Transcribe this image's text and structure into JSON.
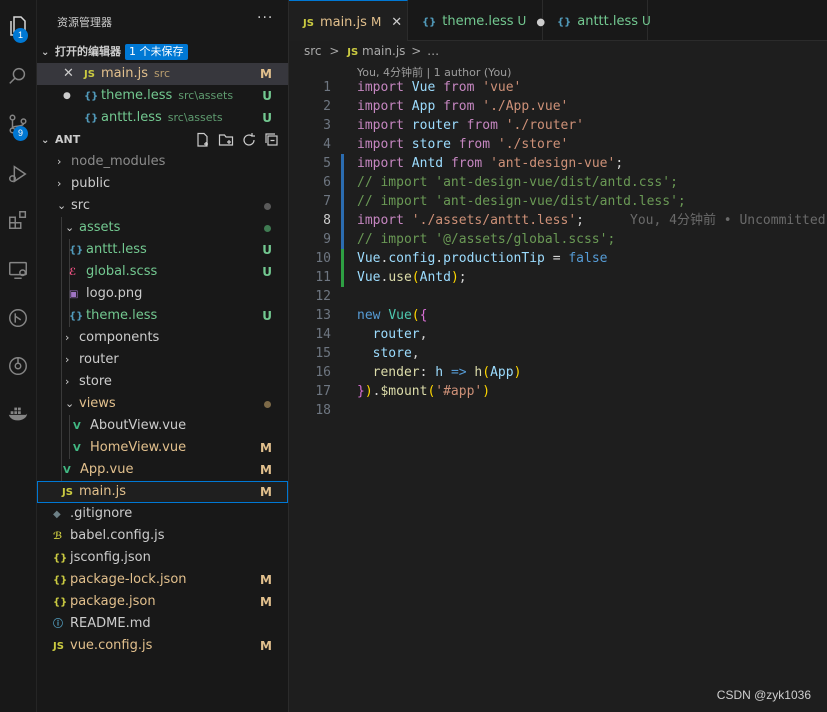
{
  "activity_bar": {
    "explorer_badge": "1",
    "scm_badge": "9"
  },
  "explorer": {
    "title": "资源管理器",
    "more_icon": "···",
    "open_editors": {
      "title": "打开的编辑器",
      "unsaved_badge": "1 个未保存",
      "items": [
        {
          "prefix": "✕",
          "icon": "JS",
          "name": "main.js",
          "path": "src",
          "status": "M"
        },
        {
          "prefix": "●",
          "icon": "{}",
          "name": "theme.less",
          "path": "src\\assets",
          "status": "U"
        },
        {
          "prefix": "",
          "icon": "{}",
          "name": "anttt.less",
          "path": "src\\assets",
          "status": "U"
        }
      ]
    },
    "project": {
      "title": "ANT",
      "tree": [
        {
          "chev": "›",
          "icon": "",
          "name": "node_modules",
          "status": ""
        },
        {
          "chev": "›",
          "icon": "",
          "name": "public",
          "status": ""
        },
        {
          "chev": "⌄",
          "icon": "",
          "name": "src",
          "status": ""
        },
        {
          "chev": "⌄",
          "icon": "",
          "name": "assets",
          "status": ""
        },
        {
          "chev": "",
          "icon": "{}",
          "name": "anttt.less",
          "status": "U"
        },
        {
          "chev": "",
          "icon": "ℰ",
          "name": "global.scss",
          "status": "U"
        },
        {
          "chev": "",
          "icon": "▣",
          "name": "logo.png",
          "status": ""
        },
        {
          "chev": "",
          "icon": "{}",
          "name": "theme.less",
          "status": "U"
        },
        {
          "chev": "›",
          "icon": "",
          "name": "components",
          "status": ""
        },
        {
          "chev": "›",
          "icon": "",
          "name": "router",
          "status": ""
        },
        {
          "chev": "›",
          "icon": "",
          "name": "store",
          "status": ""
        },
        {
          "chev": "⌄",
          "icon": "",
          "name": "views",
          "status": ""
        },
        {
          "chev": "",
          "icon": "V",
          "name": "AboutView.vue",
          "status": ""
        },
        {
          "chev": "",
          "icon": "V",
          "name": "HomeView.vue",
          "status": "M"
        },
        {
          "chev": "",
          "icon": "V",
          "name": "App.vue",
          "status": "M"
        },
        {
          "chev": "",
          "icon": "JS",
          "name": "main.js",
          "status": "M"
        },
        {
          "chev": "",
          "icon": "◆",
          "name": ".gitignore",
          "status": ""
        },
        {
          "chev": "",
          "icon": "ℬ",
          "name": "babel.config.js",
          "status": ""
        },
        {
          "chev": "",
          "icon": "{}",
          "name": "jsconfig.json",
          "status": ""
        },
        {
          "chev": "",
          "icon": "{}",
          "name": "package-lock.json",
          "status": "M"
        },
        {
          "chev": "",
          "icon": "{}",
          "name": "package.json",
          "status": "M"
        },
        {
          "chev": "",
          "icon": "ⓘ",
          "name": "README.md",
          "status": ""
        },
        {
          "chev": "",
          "icon": "JS",
          "name": "vue.config.js",
          "status": "M"
        }
      ]
    }
  },
  "tabs": [
    {
      "icon": "JS",
      "label": "main.js",
      "status": "M",
      "right": "✕"
    },
    {
      "icon": "{}",
      "label": "theme.less",
      "status": "U",
      "right": "●"
    },
    {
      "icon": "{}",
      "label": "anttt.less",
      "status": "U",
      "right": ""
    }
  ],
  "breadcrumb": {
    "folder": "src",
    "sep": ">",
    "icon": "JS",
    "file": "main.js",
    "more": "…"
  },
  "blame": {
    "header": "You, 4分钟前 | 1 author (You)"
  },
  "editor": {
    "lines": [
      {
        "n": "1",
        "code": "<span class='cf'>import</span> <span class='id'>Vue</span> <span class='cf'>from</span> <span class='str'>'vue'</span>",
        "mark": ""
      },
      {
        "n": "2",
        "code": "<span class='cf'>import</span> <span class='id'>App</span> <span class='cf'>from</span> <span class='str'>'./App.vue'</span>",
        "mark": ""
      },
      {
        "n": "3",
        "code": "<span class='cf'>import</span> <span class='id'>router</span> <span class='cf'>from</span> <span class='str'>'./router'</span>",
        "mark": ""
      },
      {
        "n": "4",
        "code": "<span class='cf'>import</span> <span class='id'>store</span> <span class='cf'>from</span> <span class='str'>'./store'</span>",
        "mark": ""
      },
      {
        "n": "5",
        "code": "<span class='cf'>import</span> <span class='id'>Antd</span> <span class='cf'>from</span> <span class='str'>'ant-design-vue'</span><span class='pl'>;</span>",
        "mark": "#2b6cb0"
      },
      {
        "n": "6",
        "code": "<span class='cm'>// import 'ant-design-vue/dist/antd.css';</span>",
        "mark": "#2b6cb0"
      },
      {
        "n": "7",
        "code": "<span class='cm'>// import 'ant-design-vue/dist/antd.less';</span>",
        "mark": "#2b6cb0"
      },
      {
        "n": "8",
        "code": "<span class='cf'>import</span> <span class='str'>'./assets/anttt.less'</span><span class='pl'>;</span>",
        "mark": "#2b6cb0",
        "annot": "You, 4分钟前 • Uncommitted"
      },
      {
        "n": "9",
        "code": "<span class='cm'>// import '@/assets/global.scss';</span>",
        "mark": "#2b6cb0"
      },
      {
        "n": "10",
        "code": "<span class='id'>Vue</span><span class='pl'>.</span><span class='id'>config</span><span class='pl'>.</span><span class='id'>productionTip</span> <span class='pl'>=</span> <span class='kw'>false</span>",
        "mark": "#2ea043"
      },
      {
        "n": "11",
        "code": "<span class='id'>Vue</span><span class='pl'>.</span><span class='fn'>use</span><span class='br1'>(</span><span class='id'>Antd</span><span class='br1'>)</span><span class='pl'>;</span>",
        "mark": "#2ea043"
      },
      {
        "n": "12",
        "code": "",
        "mark": ""
      },
      {
        "n": "13",
        "code": "<span class='kw'>new</span> <span class='cls'>Vue</span><span class='br1'>(</span><span class='br2'>{</span>",
        "mark": ""
      },
      {
        "n": "14",
        "code": "  <span class='id'>router</span><span class='pl'>,</span>",
        "mark": ""
      },
      {
        "n": "15",
        "code": "  <span class='id'>store</span><span class='pl'>,</span>",
        "mark": ""
      },
      {
        "n": "16",
        "code": "  <span class='fn'>render</span><span class='pl'>:</span> <span class='id'>h</span> <span class='kw'>=&gt;</span> <span class='fn'>h</span><span class='br1'>(</span><span class='id'>App</span><span class='br1'>)</span>",
        "mark": ""
      },
      {
        "n": "17",
        "code": "<span class='br2'>}</span><span class='br1'>)</span><span class='pl'>.</span><span class='fn'>$mount</span><span class='br1'>(</span><span class='str'>'#app'</span><span class='br1'>)</span>",
        "mark": ""
      },
      {
        "n": "18",
        "code": "",
        "mark": ""
      }
    ]
  },
  "watermark": "CSDN @zyk1036"
}
